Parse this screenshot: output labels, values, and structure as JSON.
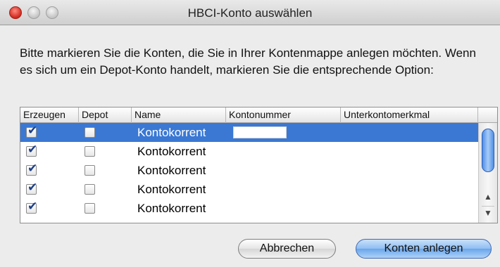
{
  "window": {
    "title": "HBCI-Konto auswählen"
  },
  "message": "Bitte markieren Sie die Konten, die Sie in Ihrer Kontenmappe anlegen möchten. Wenn es sich um ein Depot-Konto handelt, markieren Sie die entsprechende Option:",
  "table": {
    "columns": [
      "Erzeugen",
      "Depot",
      "Name",
      "Kontonummer",
      "Unterkontomerkmal"
    ],
    "rows": [
      {
        "erzeugen": true,
        "depot": false,
        "name": "Kontokorrent",
        "selected": true
      },
      {
        "erzeugen": true,
        "depot": false,
        "name": "Kontokorrent",
        "selected": false
      },
      {
        "erzeugen": true,
        "depot": false,
        "name": "Kontokorrent",
        "selected": false
      },
      {
        "erzeugen": true,
        "depot": false,
        "name": "Kontokorrent",
        "selected": false
      },
      {
        "erzeugen": true,
        "depot": false,
        "name": "Kontokorrent",
        "selected": false
      }
    ]
  },
  "buttons": {
    "cancel": "Abbrechen",
    "confirm": "Konten anlegen"
  },
  "colors": {
    "selection": "#3a78d4",
    "primary_button": "#6aa5ea"
  }
}
